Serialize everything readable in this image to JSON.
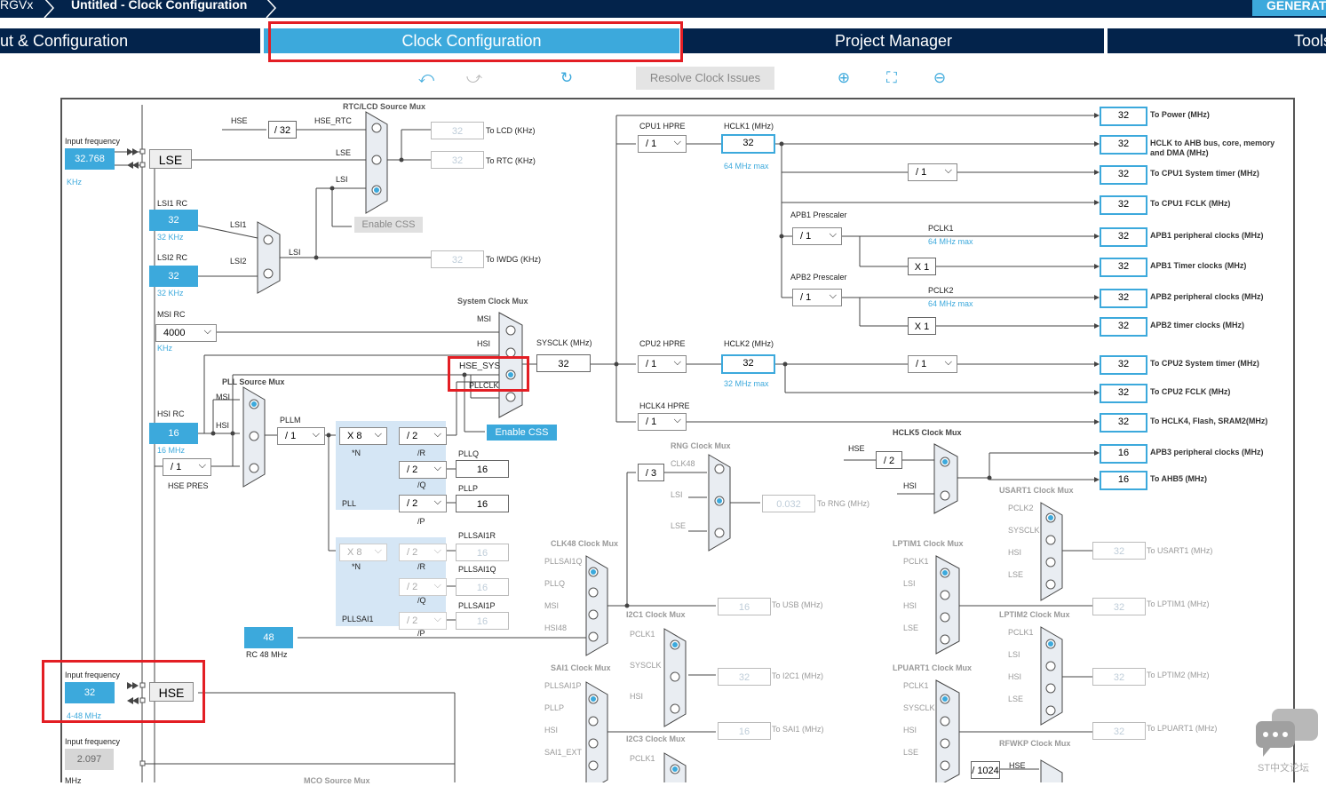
{
  "breadcrumb": {
    "device": "RGVx",
    "title": "Untitled - Clock Configuration",
    "generate_label": "GENERATE"
  },
  "tabs": {
    "pinout": "ut & Configuration",
    "clock": "Clock Configuration",
    "project": "Project Manager",
    "tools": "Tools"
  },
  "toolbar": {
    "resolve_label": "Resolve Clock Issues",
    "undo_icon": "undo-icon",
    "redo_icon": "redo-icon",
    "refresh_icon": "refresh-icon",
    "zoom_in_icon": "zoom-in-icon",
    "fit_icon": "fit-screen-icon",
    "zoom_out_icon": "zoom-out-icon"
  },
  "inputs": {
    "input_frequency_label": "Input frequency",
    "lse_value": "32.768",
    "lse_unit": "KHz",
    "lse_label": "LSE",
    "lsi1_rc": "LSI1 RC",
    "lsi1_value": "32",
    "lsi1_unit": "32 KHz",
    "lsi2_rc": "LSI2 RC",
    "lsi2_value": "32",
    "lsi2_unit": "32 KHz",
    "msi_rc": "MSI RC",
    "msi_value": "4000",
    "msi_unit": "KHz",
    "hsi_rc": "HSI RC",
    "hsi_value": "16",
    "hsi_unit": "16 MHz",
    "hse_pres_value": "/ 1",
    "hse_pres_label": "HSE PRES",
    "rc48_value": "48",
    "rc48_label": "RC 48 MHz",
    "hse_value": "32",
    "hse_unit": "4-48 MHz",
    "hse_label": "HSE",
    "input_frequency2": "2.097",
    "unit_mhz": "MHz"
  },
  "rtc": {
    "title": "RTC/LCD Source Mux",
    "hse": "HSE",
    "div32": "/ 32",
    "hse_rtc": "HSE_RTC",
    "lse": "LSE",
    "lsi": "LSI",
    "lcd_value": "32",
    "lcd_label": "To LCD (KHz)",
    "rtc_value": "32",
    "rtc_label": "To RTC (KHz)",
    "enable_css": "Enable CSS",
    "lsi1": "LSI1",
    "lsi2": "LSI2",
    "lsi_out": "LSI",
    "iwdg_value": "32",
    "iwdg_label": "To IWDG (KHz)"
  },
  "sysclk": {
    "mux_title": "System Clock Mux",
    "msi": "MSI",
    "hsi": "HSI",
    "hse_sys": "HSE_SYS",
    "pllclk": "PLLCLK",
    "sysclk_label": "SYSCLK (MHz)",
    "sysclk_value": "32",
    "enable_css": "Enable CSS"
  },
  "pll": {
    "src_mux": "PLL Source Mux",
    "msi": "MSI",
    "hsi": "HSI",
    "pllm_label": "PLLM",
    "pllm": "/ 1",
    "n": "X 8",
    "n_label": "*N",
    "r": "/ 2",
    "r_label": "/R",
    "q": "/ 2",
    "q_label": "/Q",
    "p": "/ 2",
    "p_label": "/P",
    "pll": "PLL",
    "pllq_label": "PLLQ",
    "pllq": "16",
    "pllp_label": "PLLP",
    "pllp": "16",
    "sai_n": "X 8",
    "sai_r": "/ 2",
    "sai_q": "/ 2",
    "sai_p": "/ 2",
    "pllsai1": "PLLSAI1",
    "pllsai1r_label": "PLLSAI1R",
    "pllsai1r": "16",
    "pllsai1q_label": "PLLSAI1Q",
    "pllsai1q": "16",
    "pllsai1p_label": "PLLSAI1P",
    "pllsai1p": "16"
  },
  "ahb": {
    "cpu1_hpre": "CPU1 HPRE",
    "cpu1_div": "/ 1",
    "hclk1_label": "HCLK1 (MHz)",
    "hclk1": "32",
    "hclk1_max": "64 MHz max",
    "div_timer": "/ 1",
    "apb1_pres": "APB1 Prescaler",
    "apb1_div": "/ 1",
    "pclk1": "PCLK1",
    "pclk1_max": "64 MHz max",
    "x1a": "X 1",
    "apb2_pres": "APB2 Prescaler",
    "apb2_div": "/ 1",
    "pclk2": "PCLK2",
    "pclk2_max": "64 MHz max",
    "x1b": "X 1",
    "cpu2_hpre": "CPU2 HPRE",
    "cpu2_div": "/ 1",
    "hclk2_label": "HCLK2 (MHz)",
    "hclk2": "32",
    "hclk2_max": "32 MHz max",
    "cpu2_timer_div": "/ 1",
    "hclk4_hpre": "HCLK4 HPRE",
    "hclk4_div": "/ 1"
  },
  "outputs": [
    {
      "value": "32",
      "label": "To Power (MHz)"
    },
    {
      "value": "32",
      "label": "HCLK to AHB bus, core, memory and DMA (MHz)"
    },
    {
      "value": "32",
      "label": "To CPU1 System timer (MHz)"
    },
    {
      "value": "32",
      "label": "To CPU1 FCLK (MHz)"
    },
    {
      "value": "32",
      "label": "APB1 peripheral clocks (MHz)"
    },
    {
      "value": "32",
      "label": "APB1 Timer clocks (MHz)"
    },
    {
      "value": "32",
      "label": "APB2 peripheral clocks (MHz)"
    },
    {
      "value": "32",
      "label": "APB2 timer clocks (MHz)"
    },
    {
      "value": "32",
      "label": "To CPU2 System timer (MHz)"
    },
    {
      "value": "32",
      "label": "To CPU2 FCLK (MHz)"
    },
    {
      "value": "32",
      "label": "To HCLK4, Flash, SRAM2(MHz)"
    },
    {
      "value": "16",
      "label": "APB3 peripheral clocks (MHz)"
    },
    {
      "value": "16",
      "label": "To AHB5 (MHz)"
    }
  ],
  "hclk5": {
    "title": "HCLK5 Clock Mux",
    "hse": "HSE",
    "div": "/ 2",
    "hsi": "HSI"
  },
  "rng": {
    "title": "RNG Clock Mux",
    "div": "/ 3",
    "clk48": "CLK48",
    "lsi": "LSI",
    "lse": "LSE",
    "value": "0.032",
    "label": "To RNG (MHz)"
  },
  "clk48": {
    "title": "CLK48 Clock Mux",
    "in1": "PLLSAI1Q",
    "in2": "PLLQ",
    "in3": "MSI",
    "in4": "HSI48",
    "value": "16",
    "label": "To USB (MHz)"
  },
  "i2c1": {
    "title": "I2C1 Clock Mux",
    "in1": "PCLK1",
    "in2": "SYSCLK",
    "in3": "HSI",
    "value": "32",
    "label": "To I2C1 (MHz)"
  },
  "sai1": {
    "title": "SAI1 Clock Mux",
    "in1": "PLLSAI1P",
    "in2": "PLLP",
    "in3": "HSI",
    "in4": "SAI1_EXT",
    "value": "16",
    "label": "To SAI1 (MHz)"
  },
  "i2c3": {
    "title": "I2C3 Clock Mux",
    "in1": "PCLK1"
  },
  "usart1": {
    "title": "USART1 Clock Mux",
    "in1": "PCLK2",
    "in2": "SYSCLK",
    "in3": "HSI",
    "in4": "LSE",
    "value": "32",
    "label": "To USART1 (MHz)"
  },
  "lptim1": {
    "title": "LPTIM1 Clock Mux",
    "in1": "PCLK1",
    "in2": "LSI",
    "in3": "HSI",
    "in4": "LSE",
    "value": "32",
    "label": "To LPTIM1 (MHz)"
  },
  "lptim2": {
    "title": "LPTIM2 Clock Mux",
    "in1": "PCLK1",
    "in2": "LSI",
    "in3": "HSI",
    "in4": "LSE",
    "value": "32",
    "label": "To LPTIM2 (MHz)"
  },
  "lpuart1": {
    "title": "LPUART1 Clock Mux",
    "in1": "PCLK1",
    "in2": "SYSCLK",
    "in3": "HSI",
    "in4": "LSE",
    "value": "32",
    "label": "To LPUART1 (MHz)"
  },
  "rfwkp": {
    "title": "RFWKP Clock Mux",
    "div": "/ 1024",
    "hse": "HSE"
  },
  "mco": {
    "title": "MCO Source Mux"
  },
  "watermark": {
    "text": "ST中文论坛"
  }
}
